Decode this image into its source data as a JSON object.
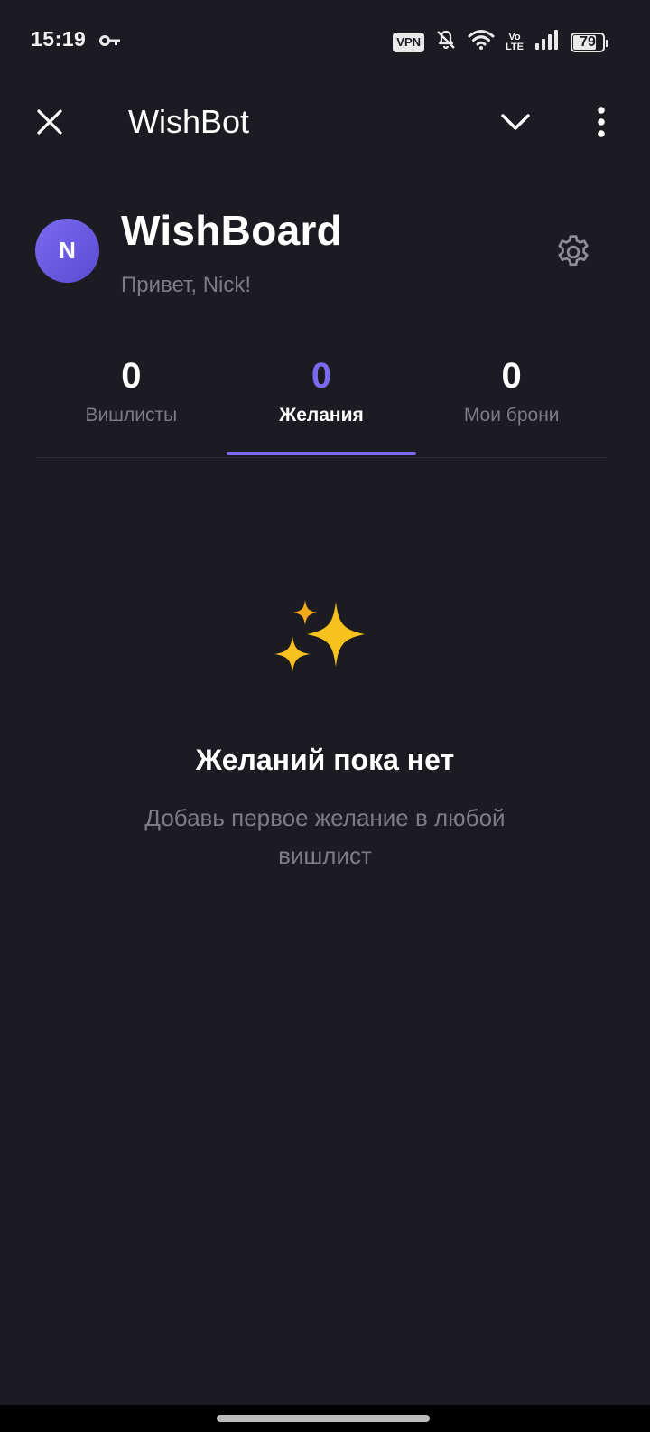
{
  "status_bar": {
    "time": "15:19",
    "vpn": "VPN",
    "volte_top": "Vo",
    "volte_bottom": "LTE",
    "battery": "79",
    "battery_level_percent": 79
  },
  "app_bar": {
    "title": "WishBot"
  },
  "profile": {
    "avatar_initial": "N",
    "brand": "WishBoard",
    "greeting": "Привет, Nick!"
  },
  "tabs": [
    {
      "count": "0",
      "label": "Вишлисты"
    },
    {
      "count": "0",
      "label": "Желания"
    },
    {
      "count": "0",
      "label": "Мои брони"
    }
  ],
  "active_tab": "Желания",
  "empty_state": {
    "icon": "sparkles-icon",
    "title": "Желаний пока нет",
    "text": "Добавь первое желание в любой вишлист"
  },
  "colors": {
    "background": "#1c1b21",
    "accent": "#7b6af0",
    "muted_text": "#7d7c86",
    "sparkle": "#f7c21e"
  }
}
